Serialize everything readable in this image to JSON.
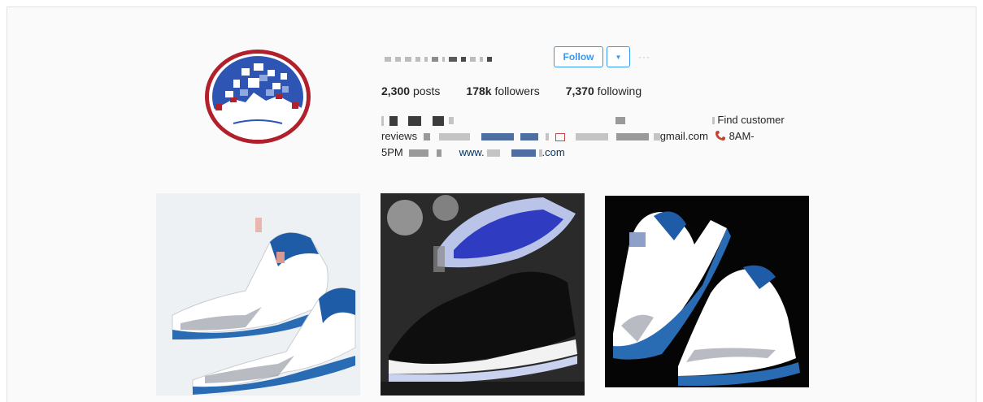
{
  "profile": {
    "username": "",
    "follow_label": "Follow",
    "dropdown_symbol": "▼",
    "more_symbol": "···",
    "stats": {
      "posts_value": "2,300",
      "posts_label": "posts",
      "followers_value": "178k",
      "followers_label": "followers",
      "following_value": "7,370",
      "following_label": "following"
    },
    "bio": {
      "find_text": "Find customer",
      "reviews_text": "reviews",
      "email_domain": "gmail.com",
      "hours_start": "8AM-",
      "hours_end": "5PM",
      "website_prefix": "www.",
      "website_suffix": ".com"
    }
  },
  "colors": {
    "accent": "#3897f0",
    "link": "#003569",
    "avatar_ring": "#b2202b"
  },
  "icons": {
    "phone": "phone-icon",
    "mail": "mail-icon",
    "dropdown": "chevron-down-icon",
    "more": "ellipsis-icon"
  },
  "posts": [
    {
      "id": "post-1",
      "subject": "white and blue sneakers"
    },
    {
      "id": "post-2",
      "subject": "black patent leather sneakers"
    },
    {
      "id": "post-3",
      "subject": "white and blue sneakers on black"
    }
  ]
}
